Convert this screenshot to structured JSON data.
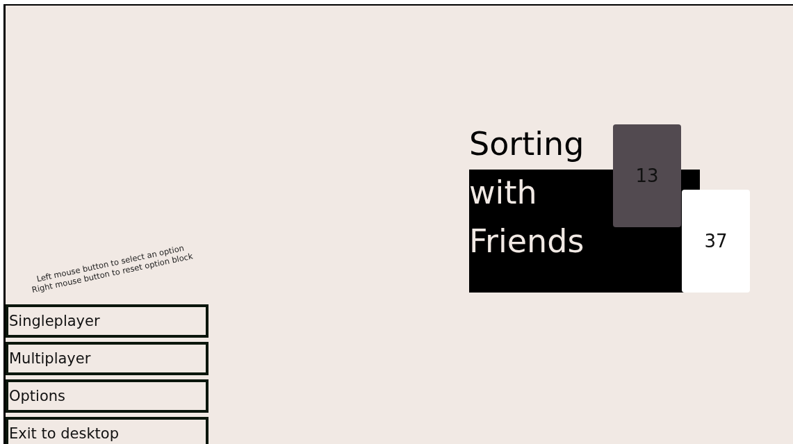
{
  "hint": [
    "Left mouse button to select an option",
    "Right mouse button to reset option block"
  ],
  "title": {
    "lines": [
      "Sorting",
      "with",
      "Friends"
    ]
  },
  "cards": [
    {
      "value": "13",
      "color": "#524a50"
    },
    {
      "value": "37",
      "color": "#ffffff"
    }
  ],
  "menu": [
    "Singleplayer",
    "Multiplayer",
    "Options",
    "Exit to desktop"
  ]
}
